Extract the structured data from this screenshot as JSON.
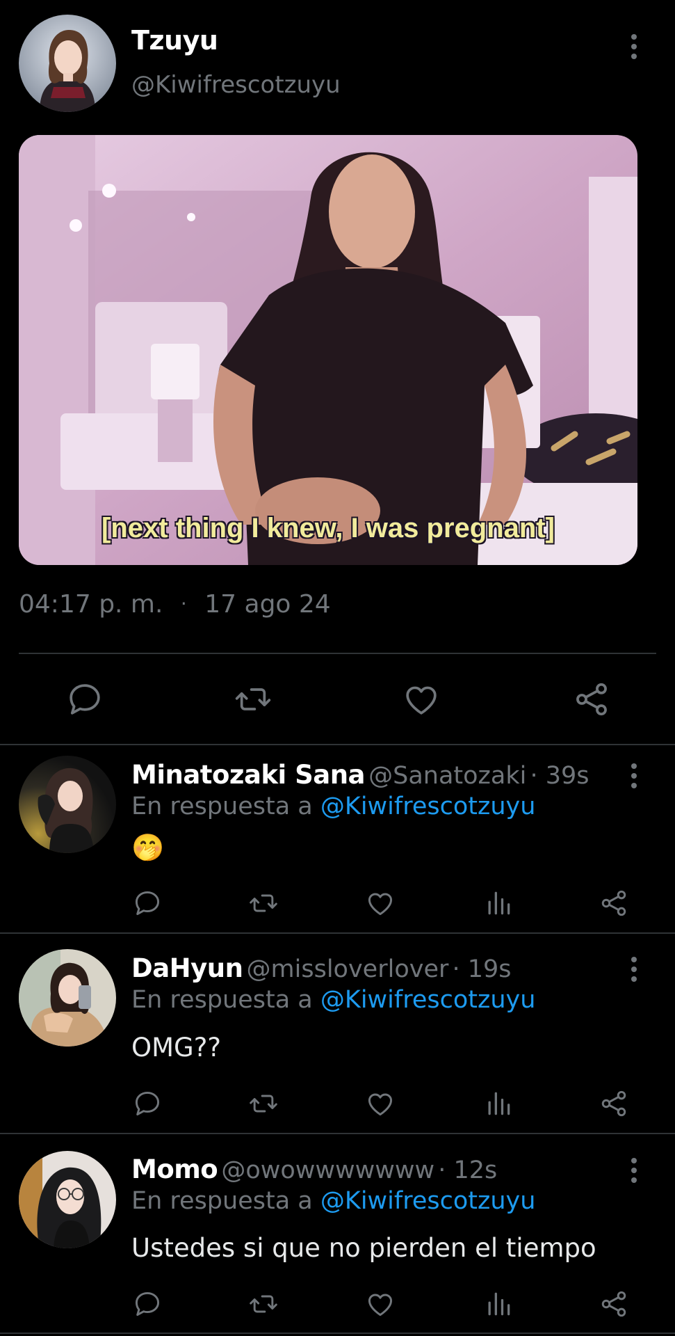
{
  "tweet": {
    "author_name": "Tzuyu",
    "author_handle": "@Kiwifrescotzuyu",
    "media_caption": "[next thing I knew, I was pregnant]",
    "time": "04:17 p. m.",
    "separator": "·",
    "date": "17 ago 24",
    "actions": [
      "reply-icon",
      "retweet-icon",
      "like-icon",
      "share-icon"
    ]
  },
  "replies": [
    {
      "name": "Minatozaki Sana",
      "handle": "@Sanatozaki",
      "age": "· 39s",
      "replying_prefix": "En respuesta a",
      "replying_to": "@Kiwifrescotzuyu",
      "text": "🤭",
      "avatar_icon": "avatar-photo"
    },
    {
      "name": "DaHyun",
      "handle": "@missloverlover",
      "age": "· 19s",
      "replying_prefix": "En respuesta a",
      "replying_to": "@Kiwifrescotzuyu",
      "text": "OMG??",
      "avatar_icon": "avatar-photo"
    },
    {
      "name": "Momo",
      "handle": "@owowwwwwww",
      "age": "· 12s",
      "replying_prefix": "En respuesta a",
      "replying_to": "@Kiwifrescotzuyu",
      "text": "Ustedes si que no pierden el tiempo",
      "avatar_icon": "avatar-photo"
    }
  ],
  "reply_actions": [
    "reply-icon",
    "retweet-icon",
    "like-icon",
    "views-icon",
    "share-icon"
  ],
  "colors": {
    "background": "#000000",
    "secondary_text": "#71767b",
    "link": "#1d9bf0",
    "divider": "#2f3336"
  }
}
